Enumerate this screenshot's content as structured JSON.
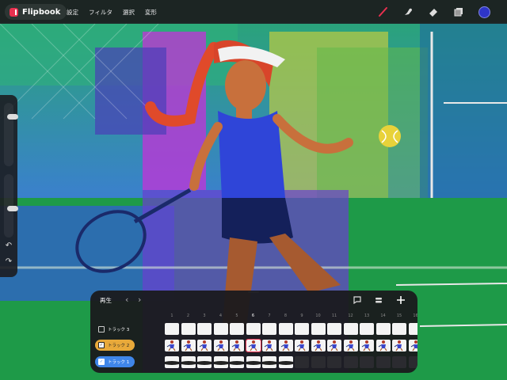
{
  "app": {
    "name": "Flipbook"
  },
  "menu": [
    "設定",
    "フィルタ",
    "選択",
    "変形"
  ],
  "tools": [
    {
      "icon": "brush-icon",
      "color": "#e8304f"
    },
    {
      "icon": "smudge-icon"
    },
    {
      "icon": "eraser-icon"
    },
    {
      "icon": "layers-icon"
    },
    {
      "icon": "color-picker",
      "color": "#2e35c8"
    }
  ],
  "sidebar": {
    "brush_size_level": 0.2,
    "opacity_level": 0.55,
    "undo_icon": "undo-icon",
    "redo_icon": "redo-icon"
  },
  "timeline": {
    "play_label": "再生",
    "current_frame": 6,
    "frame_numbers": [
      "1",
      "2",
      "3",
      "4",
      "5",
      "6",
      "7",
      "8",
      "9",
      "10",
      "11",
      "12",
      "13",
      "14",
      "15",
      "16"
    ],
    "tracks": [
      {
        "label": "トラック 3",
        "checked": false,
        "color": "",
        "frames": "blank-filled"
      },
      {
        "label": "トラック 2",
        "checked": true,
        "color": "#e8a93a",
        "frames": "poses"
      },
      {
        "label": "トラック 1",
        "checked": true,
        "color": "#3f86e8",
        "frames": "court"
      }
    ]
  }
}
